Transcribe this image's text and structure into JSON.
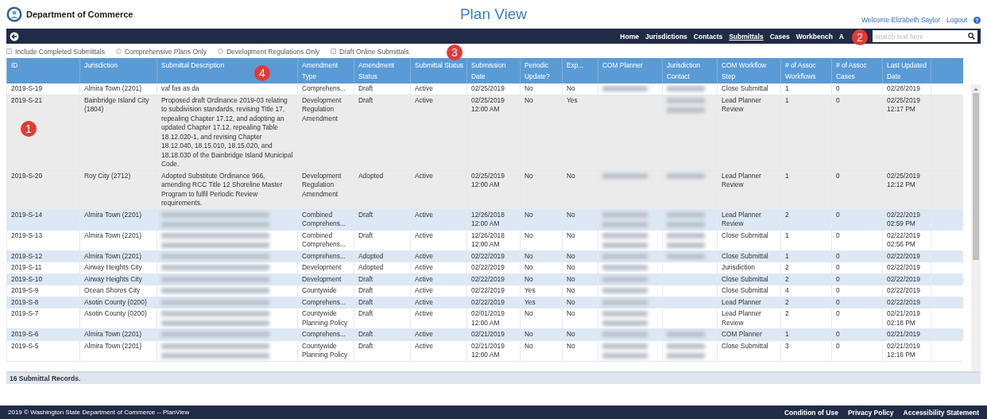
{
  "header": {
    "org": "Department of Commerce",
    "title": "Plan View",
    "welcome": "Welcome Elizabeth Saylor",
    "logout": "Logout",
    "help": "?"
  },
  "nav": {
    "items": [
      {
        "label": "Home",
        "selected": false
      },
      {
        "label": "Jurisdictions",
        "selected": false
      },
      {
        "label": "Contacts",
        "selected": false
      },
      {
        "label": "Submittals",
        "selected": true
      },
      {
        "label": "Cases",
        "selected": false
      },
      {
        "label": "Workbench",
        "selected": false
      },
      {
        "label": "A",
        "selected": false
      }
    ],
    "search": {
      "placeholder": "search text here"
    }
  },
  "filters": [
    {
      "kind": "checkbox",
      "label": "Include Completed Submittals",
      "checked": false
    },
    {
      "kind": "radio",
      "label": "Comprehensive Plans Only",
      "checked": false
    },
    {
      "kind": "radio",
      "label": "Development Regulations Only",
      "checked": false
    },
    {
      "kind": "checkbox",
      "label": "Draft Online Submittals",
      "checked": false
    }
  ],
  "table": {
    "columns": [
      "ID",
      "Jurisdiction",
      "Submittal Description",
      "Amendment Type",
      "Amendment Status",
      "Submittal Status",
      "Submission Date",
      "Periodic Update?",
      "Exp...",
      "COM Planner",
      "Jurisdiction Contact",
      "COM Workflow Step",
      "# of Assoc Workflows",
      "# of Assoc Cases",
      "Last Updated Date"
    ],
    "rows": [
      {
        "highlighted": false,
        "hovered": false,
        "cells": [
          "2019-S-19",
          "Almira Town (2201)",
          "vaf fas as da",
          "Comprehens...",
          "Draft",
          "Active",
          "02/25/2019",
          "No",
          "No",
          {
            "kind": "blurred",
            "multiline": false
          },
          {
            "kind": "blurred",
            "multiline": false
          },
          "Close Submittal",
          "1",
          "0",
          "02/28/2019"
        ]
      },
      {
        "highlighted": false,
        "hovered": true,
        "cells": [
          "2019-S-21",
          "Bainbridge Island City (1804)",
          "Proposed draft Ordinance 2019-03 relating to subdivision standards, revising Title 17, repealing Chapter 17.12, and adopting an updated Chapter 17.12, repealing Table 18.12.020-1, and revising Chapter 18.12.040, 18.15.010, 18.15.020, and 18.18.030 of the Bainbridge Island Municipal Code.",
          "Development Regulation Amendment",
          "Draft",
          "Active",
          "02/25/2019 12:00 AM",
          "No",
          "Yes",
          null,
          {
            "kind": "blurred",
            "multiline": true
          },
          "Lead Planner Review",
          "1",
          "0",
          "02/25/2019 12:17 PM"
        ]
      },
      {
        "highlighted": false,
        "hovered": true,
        "cells": [
          "2019-S-20",
          "Roy City (2712)",
          "Adopted Substitute Ordinance 966, amending RCC Title 12 Shoreline Master Program to fulfil Periodic Review requirements.",
          "Development Regulation Amendment",
          "Adopted",
          "Active",
          "02/25/2019 12:00 AM",
          "No",
          "No",
          {
            "kind": "blurred",
            "multiline": false
          },
          {
            "kind": "blurred",
            "multiline": false
          },
          "Lead Planner Review",
          "1",
          "0",
          "02/25/2019 12:12 PM"
        ]
      },
      {
        "highlighted": true,
        "hovered": false,
        "cells": [
          "2019-S-14",
          "Almira Town (2201)",
          {
            "kind": "blurred",
            "multiline": true
          },
          "Combined Comprehens...",
          "Draft",
          "Active",
          "12/26/2018 12:00 AM",
          "No",
          "No",
          {
            "kind": "blurred",
            "multiline": true
          },
          {
            "kind": "blurred",
            "multiline": true
          },
          "Lead Planner Review",
          "2",
          "0",
          "02/22/2019 02:59 PM"
        ]
      },
      {
        "highlighted": false,
        "hovered": false,
        "cells": [
          "2019-S-13",
          "Almira Town (2201)",
          {
            "kind": "blurred",
            "multiline": true
          },
          "Combined Comprehens...",
          "Draft",
          "Active",
          "12/26/2018 12:00 AM",
          "No",
          "No",
          {
            "kind": "blurred",
            "multiline": true
          },
          {
            "kind": "blurred",
            "multiline": true
          },
          "Close Submittal",
          "1",
          "0",
          "02/22/2019 02:56 PM"
        ]
      },
      {
        "highlighted": true,
        "hovered": false,
        "cells": [
          "2019-S-12",
          "Almira Town (2201)",
          {
            "kind": "blurred",
            "multiline": false
          },
          "Comprehens...",
          "Adopted",
          "Active",
          "02/22/2019",
          "No",
          "No",
          {
            "kind": "blurred",
            "multiline": false
          },
          {
            "kind": "blurred",
            "multiline": false
          },
          "Close Submittal",
          "1",
          "0",
          "02/22/2019"
        ]
      },
      {
        "highlighted": false,
        "hovered": false,
        "cells": [
          "2019-S-11",
          "Airway Heights City",
          {
            "kind": "blurred",
            "multiline": false
          },
          "Development",
          "Adopted",
          "Active",
          "02/22/2019",
          "No",
          "No",
          {
            "kind": "blurred",
            "multiline": false
          },
          null,
          "Jurisdiction",
          "2",
          "0",
          "02/22/2019"
        ]
      },
      {
        "highlighted": true,
        "hovered": false,
        "cells": [
          "2019-S-10",
          "Airway Heights City",
          {
            "kind": "blurred",
            "multiline": false
          },
          "Development",
          "Draft",
          "Active",
          "02/22/2019",
          "No",
          "No",
          {
            "kind": "blurred",
            "multiline": false
          },
          null,
          "Close Submittal",
          "2",
          "0",
          "02/22/2019"
        ]
      },
      {
        "highlighted": false,
        "hovered": false,
        "cells": [
          "2019-S-9",
          "Ocean Shores City",
          {
            "kind": "blurred",
            "multiline": false
          },
          "Countywide",
          "Draft",
          "Active",
          "02/22/2019",
          "Yes",
          "No",
          {
            "kind": "blurred",
            "multiline": false
          },
          null,
          "Close Submittal",
          "4",
          "0",
          "02/22/2019"
        ]
      },
      {
        "highlighted": true,
        "hovered": false,
        "cells": [
          "2019-S-8",
          "Asotin County (0200)",
          {
            "kind": "blurred",
            "multiline": false
          },
          "Comprehens...",
          "Draft",
          "Active",
          "02/22/2019",
          "Yes",
          "No",
          {
            "kind": "blurred",
            "multiline": false
          },
          null,
          "Lead Planner",
          "2",
          "0",
          "02/22/2019"
        ]
      },
      {
        "highlighted": false,
        "hovered": false,
        "cells": [
          "2019-S-7",
          "Asotin County (0200)",
          {
            "kind": "blurred",
            "multiline": true
          },
          "Countywide Planning Policy",
          "Draft",
          "Active",
          "02/01/2019 12:00 AM",
          "No",
          "No",
          {
            "kind": "blurred",
            "multiline": true
          },
          null,
          "Lead Planner Review",
          "2",
          "0",
          "02/21/2019 02:18 PM"
        ]
      },
      {
        "highlighted": true,
        "hovered": false,
        "cells": [
          "2019-S-6",
          "Almira Town (2201)",
          {
            "kind": "blurred",
            "multiline": false
          },
          "Comprehens...",
          "Draft",
          "Active",
          "02/21/2019",
          "No",
          "No",
          {
            "kind": "blurred",
            "multiline": false
          },
          {
            "kind": "blurred",
            "multiline": false
          },
          "COM Planner",
          "1",
          "0",
          "02/21/2019"
        ]
      },
      {
        "highlighted": false,
        "hovered": false,
        "cells": [
          "2019-S-5",
          "Almira Town (2201)",
          {
            "kind": "blurred",
            "multiline": true
          },
          "Countywide Planning Policy",
          "Draft",
          "Active",
          "02/21/2019 12:00 AM",
          "No",
          "No",
          {
            "kind": "blurred",
            "multiline": true
          },
          {
            "kind": "blurred",
            "multiline": true
          },
          "Close Submittal",
          "3",
          "0",
          "02/21/2019 12:16 PM"
        ]
      }
    ]
  },
  "record_count": "16 Submittal Records.",
  "footer": {
    "copyright": "2019 © Washington State Department of Commerce -- PlanView",
    "links": [
      "Condition of Use",
      "Privacy Policy",
      "Accessibility Statement"
    ]
  },
  "annotations": [
    "1",
    "2",
    "3",
    "4"
  ]
}
